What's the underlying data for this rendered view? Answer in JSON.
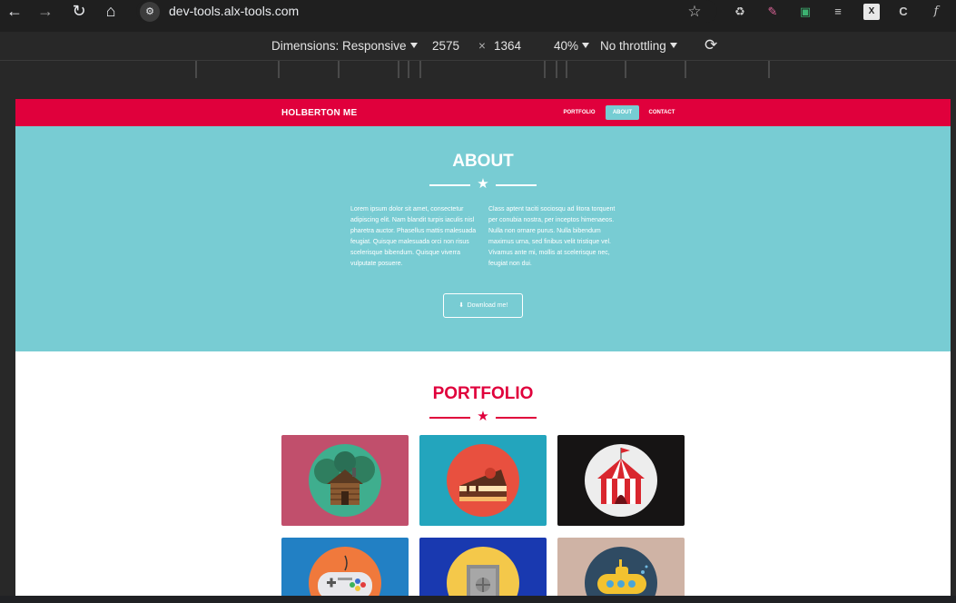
{
  "browser": {
    "url": "dev-tools.alx-tools.com",
    "nav": [
      "back-icon",
      "forward-icon",
      "reload-icon",
      "home-icon"
    ],
    "extensions": [
      "star-icon",
      "recycle-icon",
      "brush-icon",
      "screenshot-icon",
      "list-icon",
      "xl-icon",
      "c-icon",
      "font-icon"
    ]
  },
  "devtools": {
    "dimensions_label": "Dimensions: Responsive",
    "width": "2575",
    "times": "×",
    "height": "1364",
    "zoom": "40%",
    "throttling": "No throttling"
  },
  "site": {
    "brand": "HOLBERTON ME",
    "nav": [
      "PORTFOLIO",
      "ABOUT",
      "CONTACT"
    ],
    "active_nav": "ABOUT",
    "colors": {
      "primary": "#e0003c",
      "accent": "#78ccd3"
    },
    "about": {
      "title": "ABOUT",
      "para_left": "Lorem ipsum dolor sit amet, consectetur adipiscing elit. Nam blandit turpis iaculis nisl pharetra auctor. Phasellus mattis malesuada feugiat. Quisque malesuada orci non risus scelerisque bibendum. Quisque viverra vulputate posuere.",
      "para_right": "Class aptent taciti sociosqu ad litora torquent per conubia nostra, per inceptos himenaeos. Nulla non ornare purus. Nulla bibendum maximus urna, sed finibus velit tristique vel. Vivamus ante mi, mollis at scelerisque nec, feugiat non dui.",
      "button": "Download me!"
    },
    "portfolio": {
      "title": "PORTFOLIO",
      "tiles": [
        {
          "icon": "cabin-icon",
          "bg": "#c14f6c",
          "disc": "#3fae8e"
        },
        {
          "icon": "cake-icon",
          "bg": "#23a5bd",
          "disc": "#e8503f"
        },
        {
          "icon": "circus-tent-icon",
          "bg": "#161414",
          "disc": "#ededed"
        },
        {
          "icon": "game-controller-icon",
          "bg": "#2280c4",
          "disc": "#f0793c"
        },
        {
          "icon": "safe-icon",
          "bg": "#1939b0",
          "disc": "#f4c84a"
        },
        {
          "icon": "submarine-icon",
          "bg": "#cfb3a5",
          "disc": "#2f4b63"
        }
      ]
    }
  }
}
